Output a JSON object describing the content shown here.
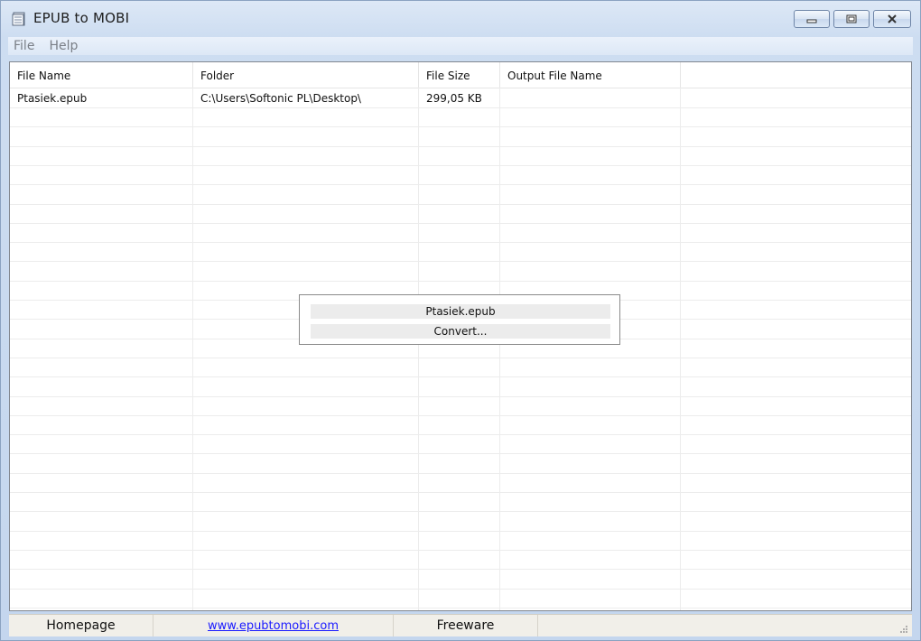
{
  "window": {
    "title": "EPUB to MOBI"
  },
  "menu": {
    "items": [
      "File",
      "Help"
    ]
  },
  "table": {
    "columns": [
      "File Name",
      "Folder",
      "File Size",
      "Output File Name",
      ""
    ],
    "rows": [
      [
        "Ptasiek.epub",
        "C:\\Users\\Softonic PL\\Desktop\\",
        "299,05 KB",
        ""
      ]
    ]
  },
  "popup": {
    "file": "Ptasiek.epub",
    "status": "Convert..."
  },
  "status": {
    "homepage": "Homepage",
    "url": "www.epubtomobi.com",
    "license": "Freeware"
  },
  "colors": {
    "link": "#1a1aff",
    "frame": "#c9daf0"
  },
  "icons": {
    "app": "book-stack-icon",
    "minimize": "minimize-icon",
    "maximize": "maximize-icon",
    "close": "close-icon"
  }
}
